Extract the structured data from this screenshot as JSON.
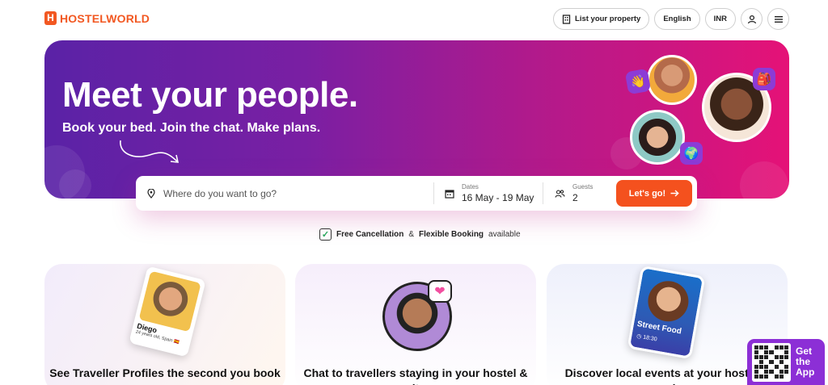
{
  "brand": {
    "logo_letter": "H",
    "name": "HOSTELWORLD",
    "color": "#f25822"
  },
  "nav": {
    "list_property": "List your property",
    "language": "English",
    "currency": "INR",
    "icons": [
      "building-icon",
      "user-icon",
      "menu-icon"
    ]
  },
  "hero": {
    "title": "Meet your people.",
    "subtitle": "Book your bed. Join the chat. Make plans.",
    "gradient": [
      "#5a22a6",
      "#7a1fa3",
      "#b01a8c",
      "#e51277"
    ],
    "badges": [
      "👋",
      "🎒",
      "🌍"
    ]
  },
  "search": {
    "where_placeholder": "Where do you want to go?",
    "dates_label": "Dates",
    "dates_value": "16 May - 19 May",
    "guests_label": "Guests",
    "guests_value": "2",
    "submit_label": "Let's go!",
    "accent": "#f4511e"
  },
  "cancellation": {
    "check_mark": "✓",
    "part1": "Free Cancellation",
    "amp": "&",
    "part2": "Flexible Booking",
    "part3": "available"
  },
  "features": [
    {
      "title": "See Traveller Profiles the second you book",
      "profile_name": "Diego",
      "profile_meta": "24 years old, Spain 🇪🇸"
    },
    {
      "title": "Chat to travellers staying in your hostel & city",
      "heart": "❤"
    },
    {
      "title": "Discover local events at your hostel & nearby",
      "event_title": "Street Food",
      "event_time": "◷ 18:30"
    }
  ],
  "get_app": {
    "line1": "Get",
    "line2": "the",
    "line3": "App"
  }
}
